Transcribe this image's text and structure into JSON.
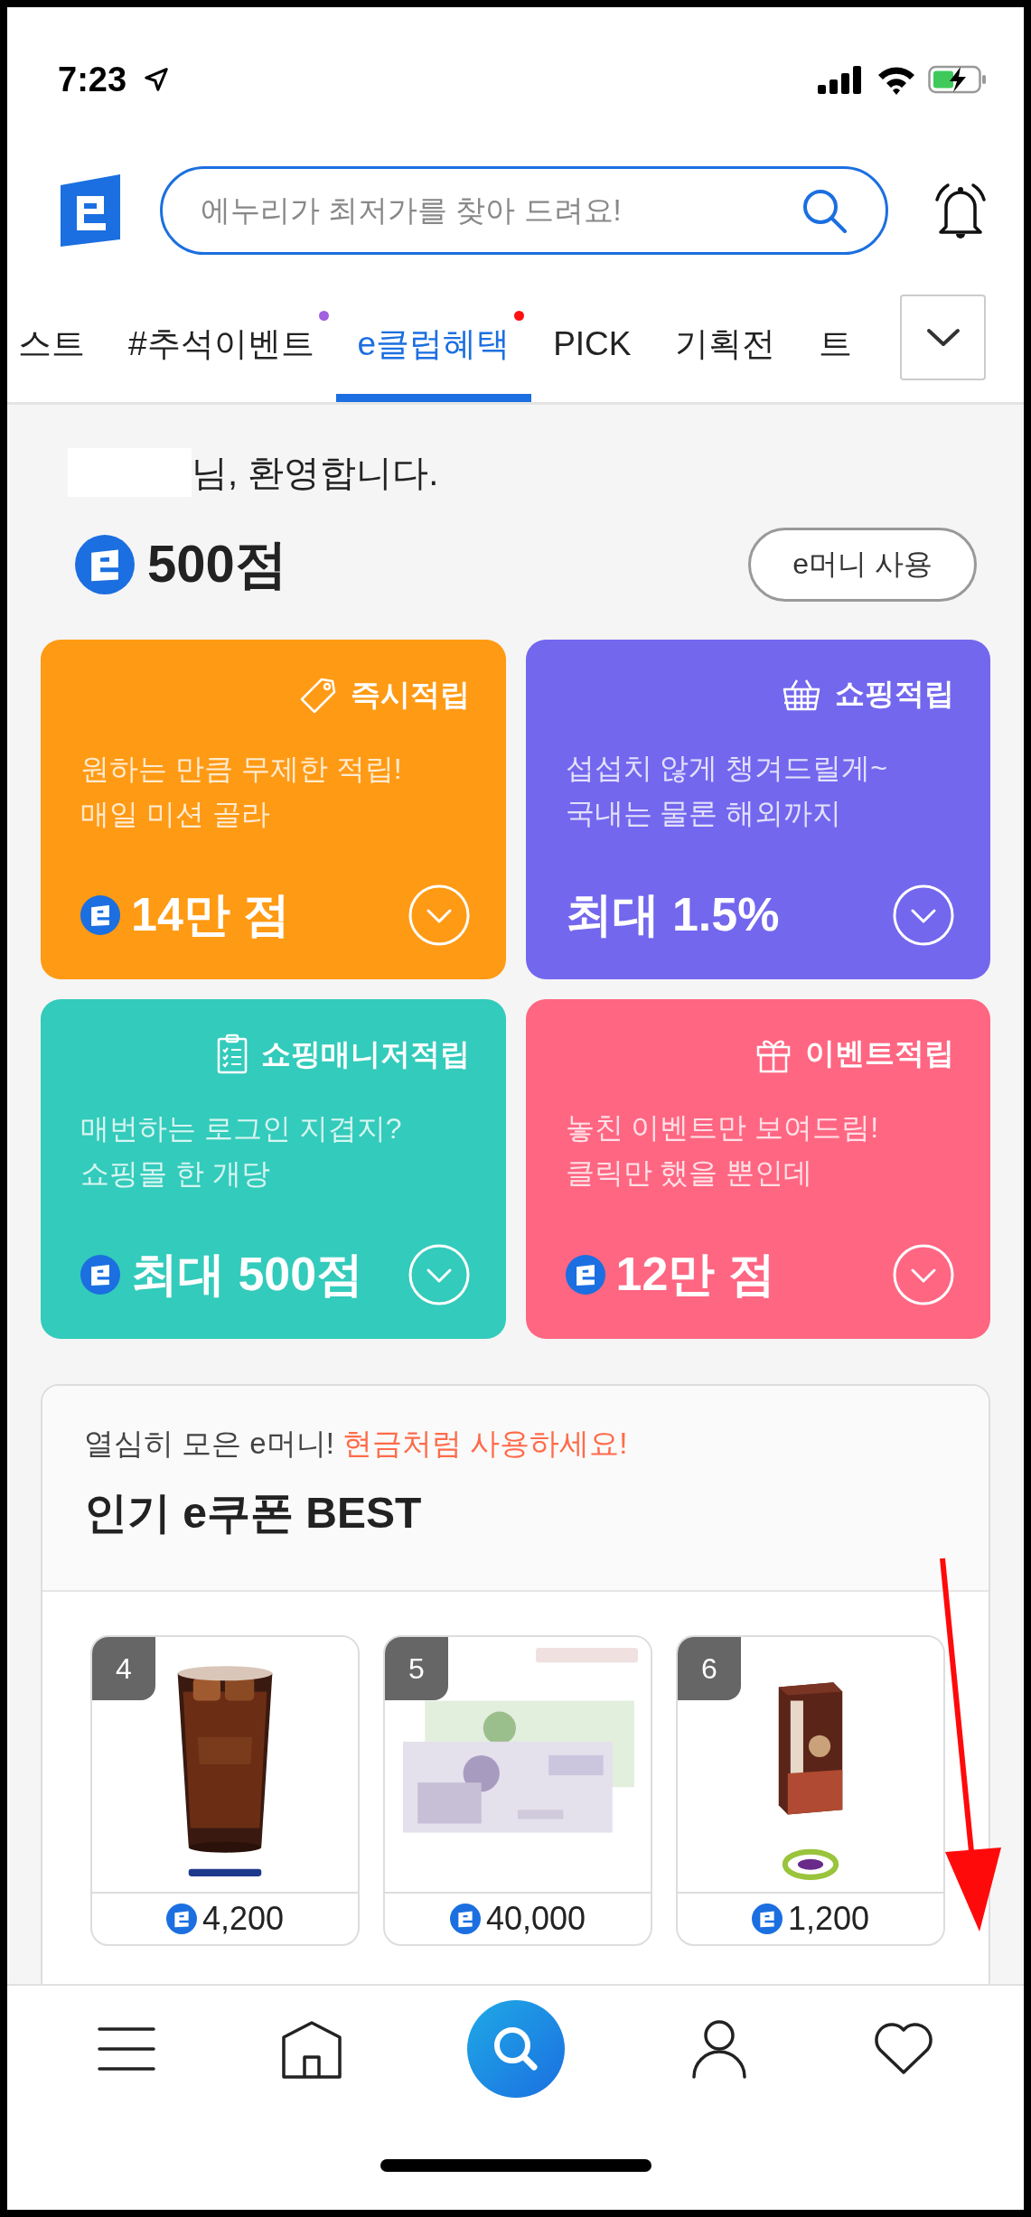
{
  "status_bar": {
    "time": "7:23"
  },
  "search": {
    "placeholder": "에누리가 최저가를 찾아 드려요!"
  },
  "tabs": [
    {
      "label": "스트",
      "selected": false
    },
    {
      "label": "#추석이벤트",
      "selected": false,
      "color": "#a060e0"
    },
    {
      "label": "e클럽혜택",
      "selected": true,
      "color": "#ff1010"
    },
    {
      "label": "PICK",
      "selected": false
    },
    {
      "label": "기획전",
      "selected": false
    },
    {
      "label": "트",
      "selected": false
    }
  ],
  "greeting": "님, 환영합니다.",
  "points": "500점",
  "emoney_button": "e머니 사용",
  "cards": [
    {
      "title": "즉시적립",
      "lines": [
        "원하는 만큼 무제한 적립!",
        "매일 미션 골라"
      ],
      "value": "14만 점",
      "coin": true,
      "color": "#ff9a14"
    },
    {
      "title": "쇼핑적립",
      "lines": [
        "섭섭치 않게 챙겨드릴게~",
        "국내는 물론 해외까지"
      ],
      "value": "최대 1.5%",
      "coin": false,
      "color": "#7367ee"
    },
    {
      "title": "쇼핑매니저적립",
      "lines": [
        "매번하는 로그인 지겹지?",
        "쇼핑몰 한 개당"
      ],
      "value": "최대 500점",
      "coin": true,
      "color": "#33cbbb"
    },
    {
      "title": "이벤트적립",
      "lines": [
        "놓친 이벤트만 보여드림!",
        "클릭만 했을 뿐인데"
      ],
      "value": "12만 점",
      "coin": true,
      "color": "#ff6682"
    }
  ],
  "coupons": {
    "tagline": "열심히 모은 e머니!",
    "highlight": "현금처럼 사용하세요!",
    "title": "인기 e쿠폰 BEST",
    "items": [
      {
        "rank": "4",
        "price": "4,200"
      },
      {
        "rank": "5",
        "price": "40,000"
      },
      {
        "rank": "6",
        "price": "1,200"
      }
    ]
  }
}
